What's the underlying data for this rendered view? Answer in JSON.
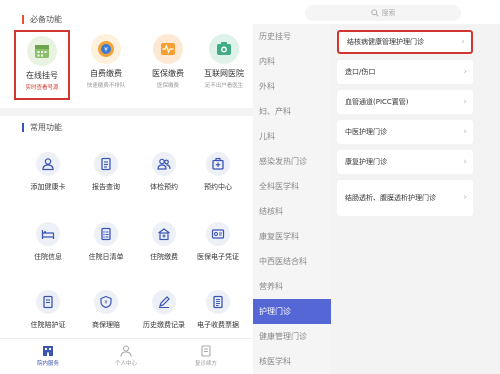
{
  "left": {
    "section1_title": "必备功能",
    "top_items": [
      {
        "label": "在线挂号",
        "sub": "实时查看号源",
        "icon": "calendar-icon",
        "color": "#8bbf6a"
      },
      {
        "label": "自费缴费",
        "sub": "快速缴费不排队",
        "icon": "coin-icon",
        "color": "#f2a33a"
      },
      {
        "label": "医保缴费",
        "sub": "医保缴费",
        "icon": "heartbeat-icon",
        "color": "#f5a033"
      },
      {
        "label": "互联网医院",
        "sub": "足不出户看医生",
        "icon": "camera-icon",
        "color": "#3fae84"
      }
    ],
    "section2_title": "常用功能",
    "common_items": [
      {
        "label": "添加健康卡",
        "icon": "user-icon"
      },
      {
        "label": "报告查询",
        "icon": "report-icon"
      },
      {
        "label": "体检预约",
        "icon": "users-icon"
      },
      {
        "label": "预约中心",
        "icon": "medical-box-icon"
      },
      {
        "label": "住院信息",
        "icon": "bed-icon"
      },
      {
        "label": "住院日清单",
        "icon": "list-icon"
      },
      {
        "label": "住院缴费",
        "icon": "hospital-icon"
      },
      {
        "label": "医保电子凭证",
        "icon": "card-icon"
      },
      {
        "label": "住院陪护证",
        "icon": "document-icon"
      },
      {
        "label": "商保理赔",
        "icon": "shield-icon"
      },
      {
        "label": "历史缴费记录",
        "icon": "pen-icon"
      },
      {
        "label": "电子收费票据",
        "icon": "receipt-icon"
      }
    ],
    "nav": [
      {
        "label": "院内服务",
        "icon": "building-icon"
      },
      {
        "label": "个人中心",
        "icon": "person-icon"
      },
      {
        "label": "复诊续方",
        "icon": "prescription-icon"
      }
    ]
  },
  "right": {
    "search_placeholder": "搜索",
    "categories": [
      "历史挂号",
      "内科",
      "外科",
      "妇、产科",
      "儿科",
      "感染发热门诊",
      "全科医学科",
      "结核科",
      "康复医学科",
      "中西医结合科",
      "营养科",
      "护理门诊",
      "健康管理门诊",
      "核医学科"
    ],
    "active_category": "护理门诊",
    "sub_items": [
      "结核病健康管理护理门诊",
      "造口/伤口",
      "血管通道(PICC置管)",
      "中医护理门诊",
      "康复护理门诊",
      "结肠透析、腹膜透析护理门诊"
    ]
  },
  "colors": {
    "accent_blue": "#3a55b4",
    "active_category_bg": "#5567d4",
    "highlight_red": "#d2352f"
  }
}
